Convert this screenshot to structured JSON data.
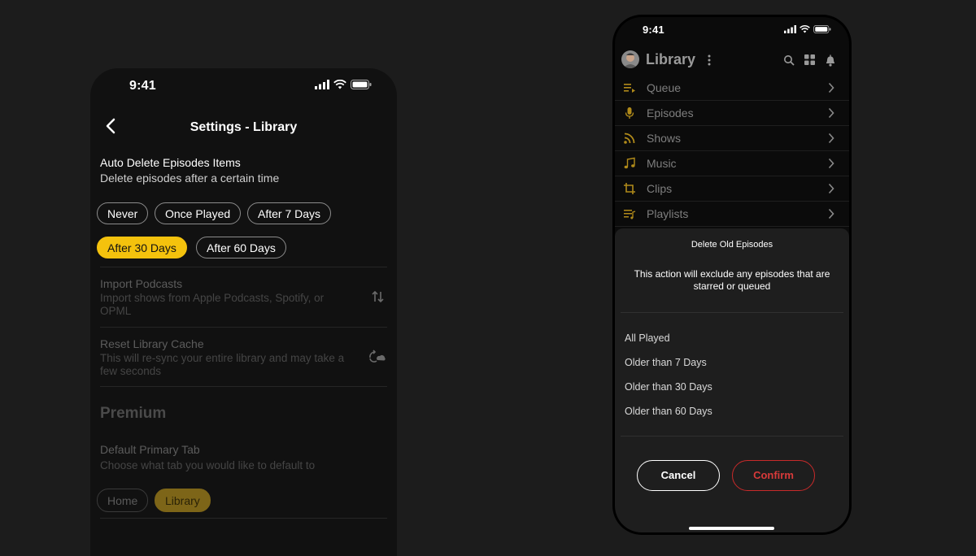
{
  "left_phone": {
    "status_time": "9:41",
    "title": "Settings - Library",
    "auto_delete": {
      "title": "Auto Delete Episodes Items",
      "subtitle": "Delete episodes after a certain time",
      "options": [
        "Never",
        "Once Played",
        "After 7 Days",
        "After 30 Days",
        "After 60 Days"
      ],
      "selected": "After 30 Days"
    },
    "import": {
      "title": "Import Podcasts",
      "subtitle": "Import shows from Apple Podcasts, Spotify, or OPML",
      "icon": "swap-vertical-icon"
    },
    "reset": {
      "title": "Reset Library Cache",
      "subtitle": "This will re-sync your entire library and may take a few seconds",
      "icon": "cloud-sync-icon"
    },
    "premium_heading": "Premium",
    "default_tab": {
      "title": "Default Primary Tab",
      "subtitle": "Choose what tab you would like to default to",
      "options": [
        "Home",
        "Library"
      ],
      "selected": "Library"
    }
  },
  "right_phone": {
    "status_time": "9:41",
    "title": "Library",
    "list": [
      {
        "label": "Queue",
        "icon": "queue-icon"
      },
      {
        "label": "Episodes",
        "icon": "microphone-icon"
      },
      {
        "label": "Shows",
        "icon": "rss-icon"
      },
      {
        "label": "Music",
        "icon": "music-note-icon"
      },
      {
        "label": "Clips",
        "icon": "crop-icon"
      },
      {
        "label": "Playlists",
        "icon": "playlist-icon"
      }
    ],
    "sheet": {
      "title": "Delete Old Episodes",
      "message": "This action will exclude any episodes that are starred or queued",
      "options": [
        "All Played",
        "Older than 7 Days",
        "Older than 30 Days",
        "Older than 60 Days"
      ],
      "cancel": "Cancel",
      "confirm": "Confirm"
    }
  },
  "colors": {
    "accent": "#f4c20d",
    "danger": "#d83a3a",
    "background": "#1c1c1c"
  }
}
